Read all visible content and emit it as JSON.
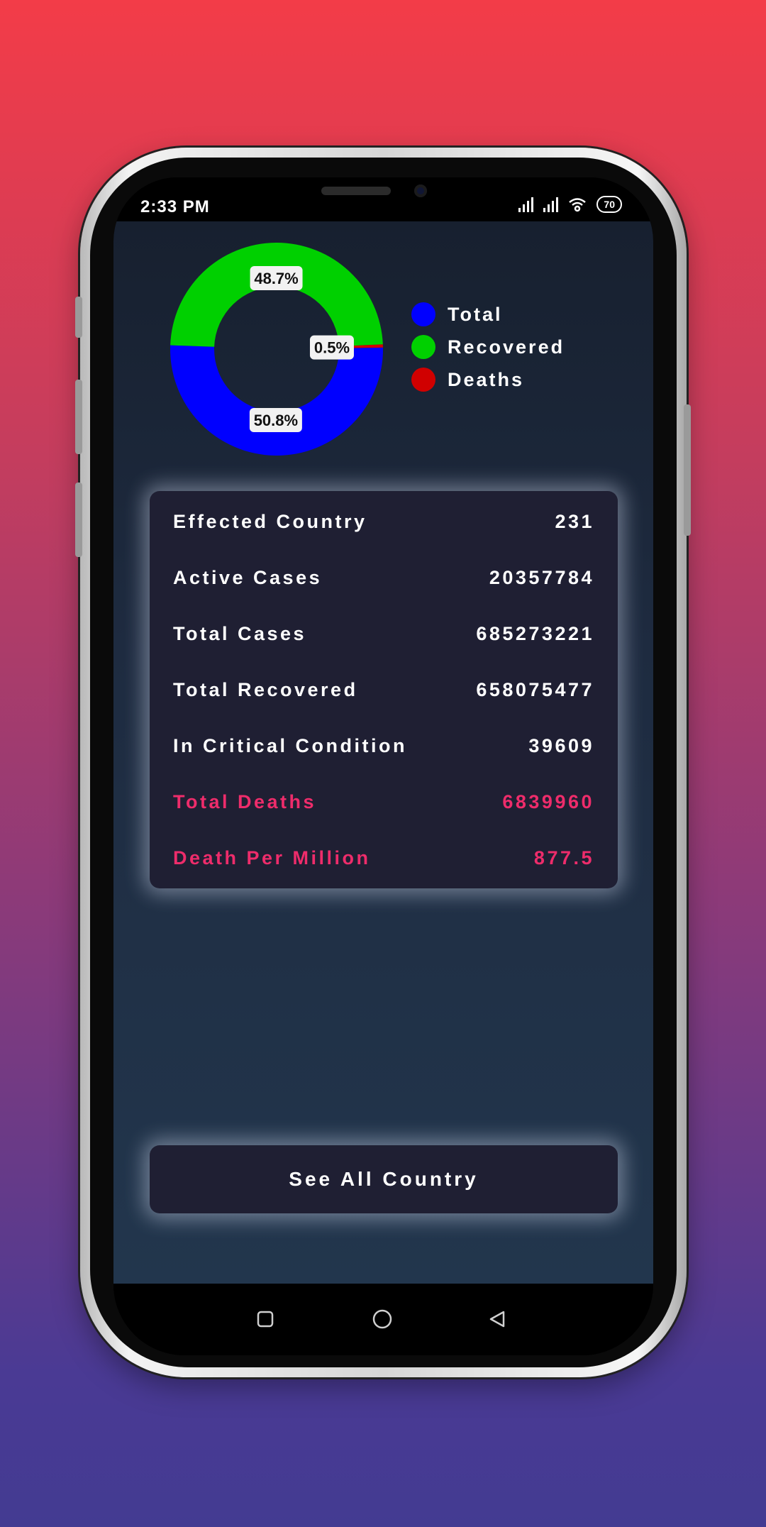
{
  "status_bar": {
    "time": "2:33 PM",
    "battery": "70"
  },
  "chart_data": {
    "type": "pie",
    "donut": true,
    "slices": [
      {
        "label": "Total",
        "value": 50.8,
        "display": "50.8%",
        "color": "#0000ff"
      },
      {
        "label": "Recovered",
        "value": 48.7,
        "display": "48.7%",
        "color": "#00d000"
      },
      {
        "label": "Deaths",
        "value": 0.5,
        "display": "0.5%",
        "color": "#d00000"
      }
    ],
    "legend_placement": "right"
  },
  "stats": [
    {
      "label": "Effected Country",
      "value": "231",
      "highlight": false
    },
    {
      "label": "Active Cases",
      "value": "20357784",
      "highlight": false
    },
    {
      "label": "Total Cases",
      "value": "685273221",
      "highlight": false
    },
    {
      "label": "Total Recovered",
      "value": "658075477",
      "highlight": false
    },
    {
      "label": "In Critical Condition",
      "value": "39609",
      "highlight": false
    },
    {
      "label": "Total Deaths",
      "value": "6839960",
      "highlight": true
    },
    {
      "label": "Death Per Million",
      "value": "877.5",
      "highlight": true
    }
  ],
  "see_all_button": {
    "label": "See All Country"
  },
  "navigation": {
    "icons": [
      "recents-icon",
      "home-icon",
      "back-icon"
    ]
  },
  "colors": {
    "highlight": "#ee2c6b",
    "card_bg": "#1f1f33"
  }
}
